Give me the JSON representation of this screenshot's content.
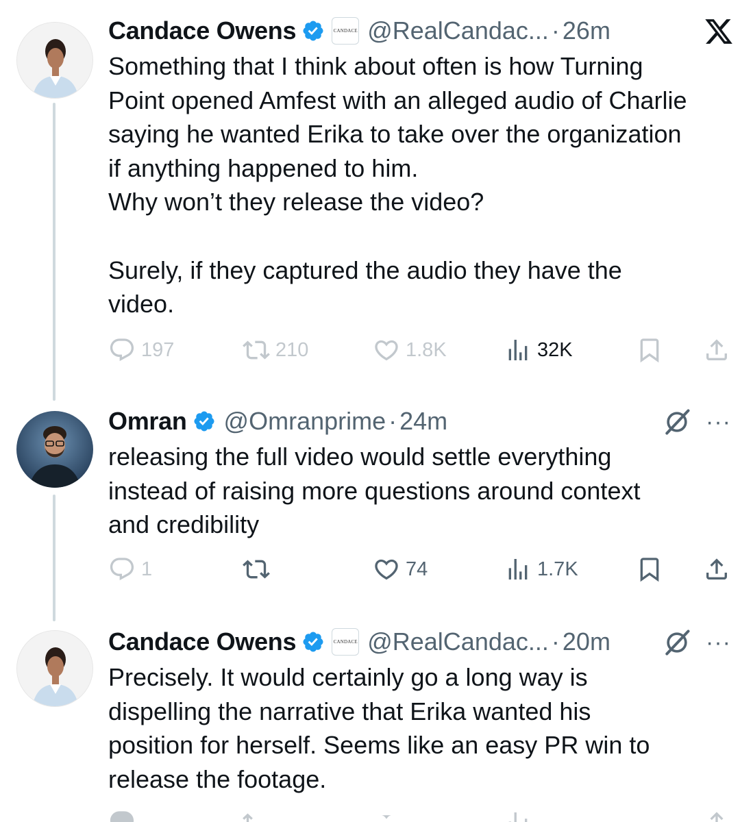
{
  "tweets": [
    {
      "name": "Candace Owens",
      "affiliate_label": "CANDACE",
      "handle": "@RealCandac...",
      "time": "26m",
      "text": "Something that I think about often is how Turning\nPoint opened Amfest with an alleged audio of Charlie\nsaying he wanted Erika to take over the organization\nif anything happened to him.\nWhy won’t they release the video?\n\nSurely, if they captured the audio they have the\nvideo.",
      "replies": "197",
      "reposts": "210",
      "likes": "1.8K",
      "views": "32K"
    },
    {
      "name": "Omran",
      "handle": "@Omranprime",
      "time": "24m",
      "text": "releasing the full video would settle everything\ninstead of raising more questions around context\nand credibility",
      "replies": "1",
      "likes": "74",
      "views": "1.7K"
    },
    {
      "name": "Candace Owens",
      "affiliate_label": "CANDACE",
      "handle": "@RealCandac...",
      "time": "20m",
      "text": "Precisely. It would certainly go a long way is\ndispelling the narrative that Erika wanted his\nposition for herself. Seems like an easy PR win to\nrelease the footage."
    }
  ],
  "colors": {
    "text": "#0f1419",
    "secondary": "#536471",
    "verified": "#1d9bf0",
    "thread_line": "#cfd9de"
  },
  "icons": [
    "x-logo-icon",
    "verified-badge-icon",
    "grok-icon",
    "more-icon",
    "reply-icon",
    "repost-icon",
    "like-icon",
    "views-icon",
    "bookmark-icon",
    "share-icon"
  ]
}
